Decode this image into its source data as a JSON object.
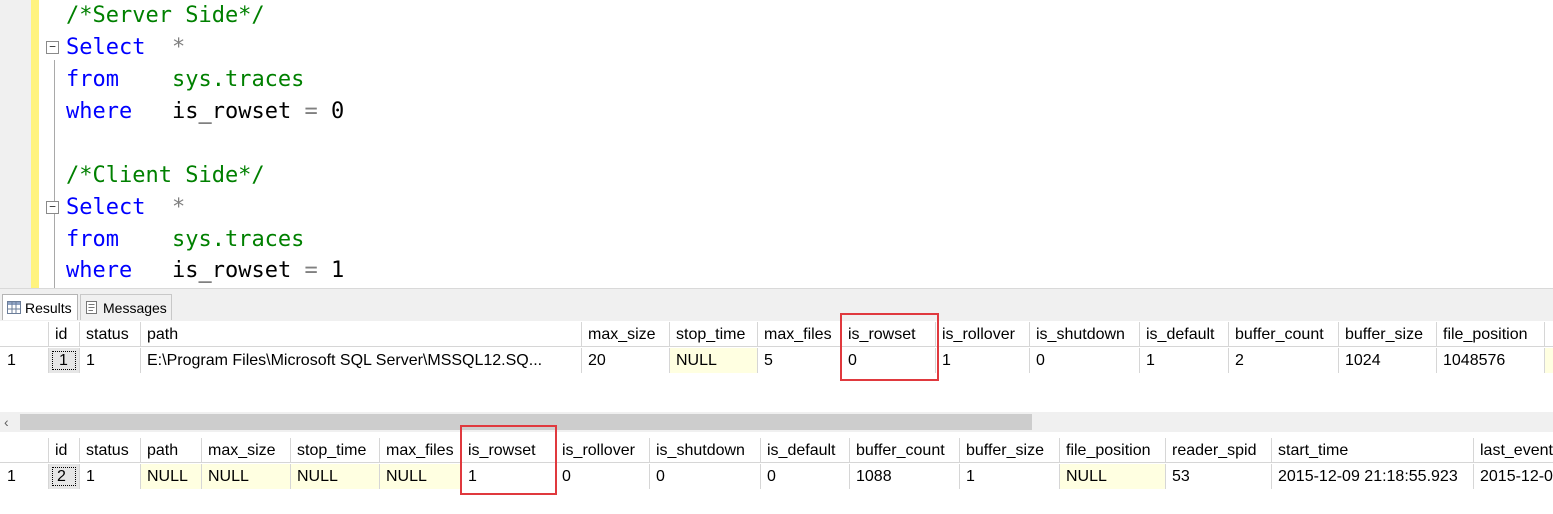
{
  "editor": {
    "lines": [
      {
        "comment": "/*Server Side*/"
      },
      {
        "keyword": "Select",
        "rest_op": "*"
      },
      {
        "keyword": "from",
        "object": "sys.traces"
      },
      {
        "keyword": "where",
        "column": "is_rowset",
        "operator": "=",
        "value": "0"
      },
      {},
      {
        "comment": "/*Client Side*/"
      },
      {
        "keyword": "Select",
        "rest_op": "*"
      },
      {
        "keyword": "from",
        "object": "sys.traces"
      },
      {
        "keyword": "where",
        "column": "is_rowset",
        "operator": "=",
        "value": "1"
      }
    ],
    "fold_symbol": "−"
  },
  "tabs": {
    "results": "Results",
    "messages": "Messages"
  },
  "grid1": {
    "headers": [
      "id",
      "status",
      "path",
      "max_size",
      "stop_time",
      "max_files",
      "is_rowset",
      "is_rollover",
      "is_shutdown",
      "is_default",
      "buffer_count",
      "buffer_size",
      "file_position"
    ],
    "row": {
      "rownum": "1",
      "cells": [
        "1",
        "1",
        "E:\\Program Files\\Microsoft SQL Server\\MSSQL12.SQ...",
        "20",
        "NULL",
        "5",
        "0",
        "1",
        "0",
        "1",
        "2",
        "1024",
        "1048576"
      ]
    }
  },
  "grid2": {
    "headers": [
      "id",
      "status",
      "path",
      "max_size",
      "stop_time",
      "max_files",
      "is_rowset",
      "is_rollover",
      "is_shutdown",
      "is_default",
      "buffer_count",
      "buffer_size",
      "file_position",
      "reader_spid",
      "start_time",
      "last_event"
    ],
    "row": {
      "rownum": "1",
      "cells": [
        "2",
        "1",
        "NULL",
        "NULL",
        "NULL",
        "NULL",
        "1",
        "0",
        "0",
        "0",
        "1088",
        "1",
        "NULL",
        "53",
        "2015-12-09 21:18:55.923",
        "2015-12-0"
      ]
    }
  },
  "colors": {
    "keyword": "#0000ff",
    "comment": "#008000",
    "highlight": "#e0393e",
    "null_cell": "#ffffe1"
  }
}
